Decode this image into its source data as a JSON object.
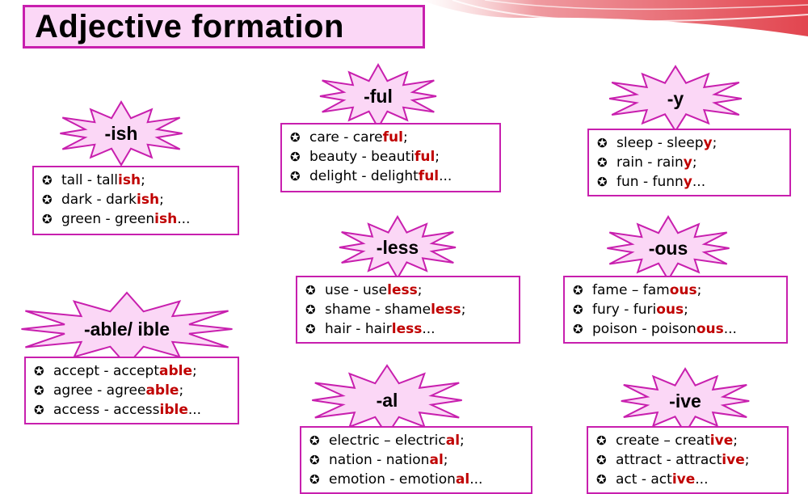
{
  "title": "Adjective formation",
  "colors": {
    "accent": "#c81fae",
    "fill": "#fbd7f6",
    "suffix": "#c00000"
  },
  "bullet_icon": "star-in-circle-icon",
  "groups": [
    {
      "id": "ish",
      "suffix": "-ish",
      "items": [
        {
          "b": "✪",
          "base": "tall - tall",
          "suf": "ish",
          "end": ";"
        },
        {
          "b": "✪",
          "base": "dark - dark",
          "suf": "ish",
          "end": ";"
        },
        {
          "b": "✪",
          "base": "green - green",
          "suf": "ish",
          "end": "..."
        }
      ]
    },
    {
      "id": "ful",
      "suffix": "-ful",
      "items": [
        {
          "b": "✪",
          "base": "care - care",
          "suf": "ful",
          "end": ";"
        },
        {
          "b": "✪",
          "base": "beauty - beauti",
          "suf": "ful",
          "end": ";"
        },
        {
          "b": "✪",
          "base": "delight - delight",
          "suf": "ful",
          "end": "..."
        }
      ]
    },
    {
      "id": "y",
      "suffix": "-y",
      "items": [
        {
          "b": "✪",
          "base": "sleep  - sleep",
          "suf": "y",
          "end": ";"
        },
        {
          "b": "✪",
          "base": "rain - rain",
          "suf": "y",
          "end": ";"
        },
        {
          "b": "✪",
          "base": "fun - funn",
          "suf": "y",
          "end": "..."
        }
      ]
    },
    {
      "id": "less",
      "suffix": "-less",
      "items": [
        {
          "b": "✪",
          "base": "use - use",
          "suf": "less",
          "end": ";"
        },
        {
          "b": "✪",
          "base": "shame - shame",
          "suf": "less",
          "end": ";"
        },
        {
          "b": "✪",
          "base": "hair - hair",
          "suf": "less",
          "end": "..."
        }
      ]
    },
    {
      "id": "ous",
      "suffix": "-ous",
      "items": [
        {
          "b": "✪",
          "base": "fame – fam",
          "suf": "ous",
          "end": ";"
        },
        {
          "b": "✪",
          "base": "fury - furi",
          "suf": "ous",
          "end": ";"
        },
        {
          "b": "✪",
          "base": "poison - poison",
          "suf": "ous",
          "end": "..."
        }
      ]
    },
    {
      "id": "able",
      "suffix": "-able/ ible",
      "items": [
        {
          "b": "✪",
          "base": "accept - accept",
          "suf": "able",
          "end": ";"
        },
        {
          "b": "✪",
          "base": "agree - agree",
          "suf": "able",
          "end": ";"
        },
        {
          "b": "✪",
          "base": "access - access",
          "suf": "ible",
          "end": "..."
        }
      ]
    },
    {
      "id": "al",
      "suffix": "-al",
      "items": [
        {
          "b": "✪",
          "base": "electric – electric",
          "suf": "al",
          "end": ";"
        },
        {
          "b": "✪",
          "base": "nation - nation",
          "suf": "al",
          "end": ";"
        },
        {
          "b": "✪",
          "base": "emotion - emotion",
          "suf": "al",
          "end": "..."
        }
      ]
    },
    {
      "id": "ive",
      "suffix": "-ive",
      "items": [
        {
          "b": "✪",
          "base": "create – creat",
          "suf": "ive",
          "end": ";"
        },
        {
          "b": "✪",
          "base": "attract - attract",
          "suf": "ive",
          "end": ";"
        },
        {
          "b": "✪",
          "base": "act - act",
          "suf": "ive",
          "end": "..."
        }
      ]
    }
  ]
}
